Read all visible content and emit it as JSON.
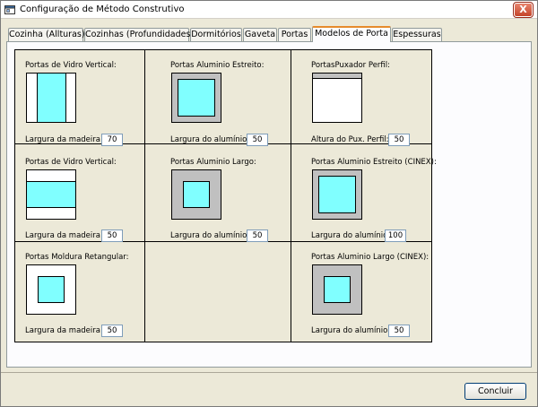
{
  "window": {
    "title": "Configuração de Método Construtivo",
    "close_label": "X"
  },
  "tabs": [
    {
      "label": "Cozinha (Allturas)",
      "active": false
    },
    {
      "label": "Cozinhas (Profundidades)",
      "active": false
    },
    {
      "label": "Dormitórios",
      "active": false
    },
    {
      "label": "Gaveta",
      "active": false
    },
    {
      "label": "Portas",
      "active": false
    },
    {
      "label": "Modelos de Porta",
      "active": true
    },
    {
      "label": "Espessuras",
      "active": false
    }
  ],
  "door_models": [
    {
      "title": "Portas de Vidro Vertical:",
      "label": "Largura da madeira:",
      "value": "70",
      "preview": "glass-vertical"
    },
    {
      "title": "Portas Aluminio Estreito:",
      "label": "Largura do alumínio:",
      "value": "50",
      "preview": "aluminium-narrow"
    },
    {
      "title": "PortasPuxador Perfil:",
      "label": "Altura do Pux. Perfil:",
      "value": "50",
      "preview": "profile-handle"
    },
    {
      "title": "Portas de Vidro Vertical:",
      "label": "Largura da madeira:",
      "value": "50",
      "preview": "glass-horizontal"
    },
    {
      "title": "Portas Aluminio Largo:",
      "label": "Largura do alumínio:",
      "value": "50",
      "preview": "aluminium-wide"
    },
    {
      "title": "Portas Aluminio Estreito (CINEX):",
      "label": "Largura do alumínio:",
      "value": "100",
      "preview": "aluminium-narrow-cinex"
    },
    {
      "title": "Portas Moldura Retangular:",
      "label": "Largura da madeira:",
      "value": "50",
      "preview": "rectangular-frame"
    },
    {
      "title": "Portas Aluminio Largo (CINEX):",
      "label": "Largura do alumínio:",
      "value": "50",
      "preview": "aluminium-wide-cinex"
    }
  ],
  "footer": {
    "finish_label": "Concluir"
  },
  "colors": {
    "glass": "#80FFFF",
    "aluminium": "#C0C0C0",
    "tab_accent": "#E68B2C"
  }
}
